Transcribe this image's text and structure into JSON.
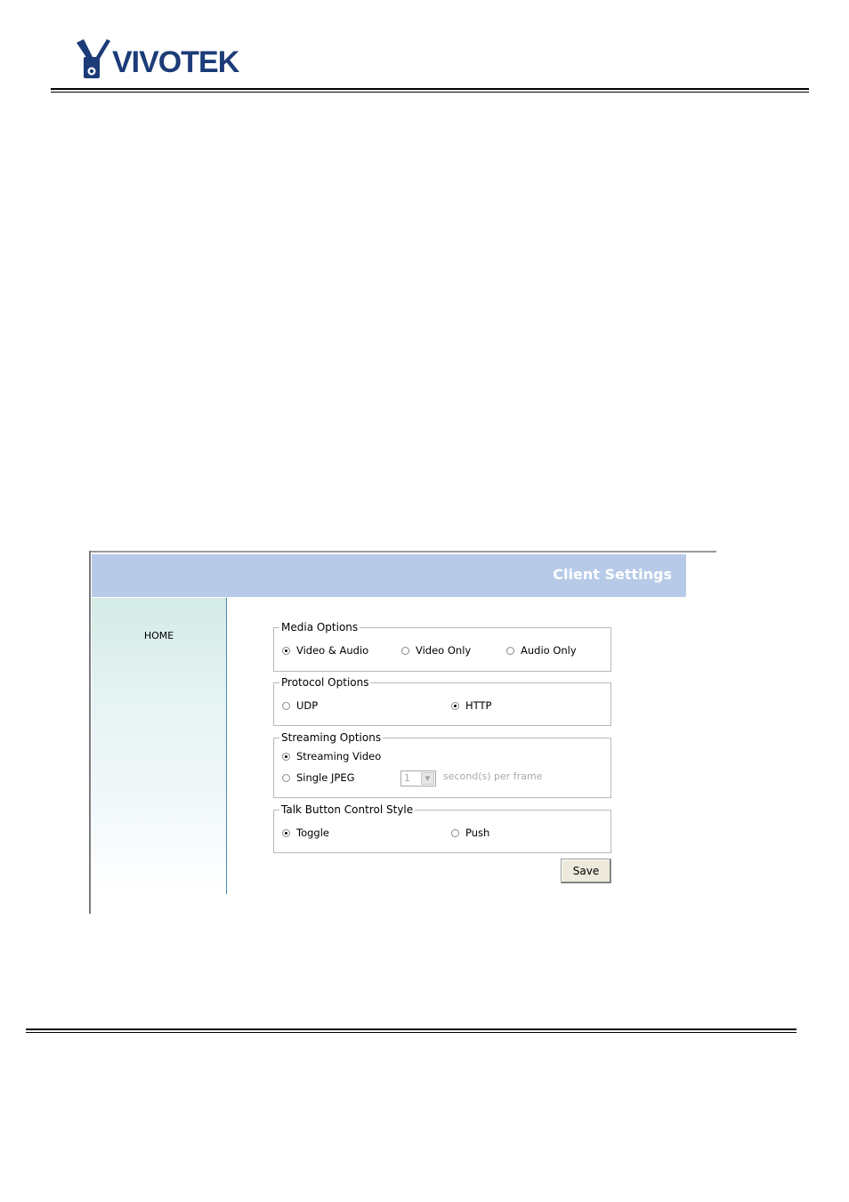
{
  "brand": {
    "logo_text": "VIVOTEK"
  },
  "window": {
    "title": "Client Settings"
  },
  "sidebar": {
    "home": "HOME"
  },
  "media_options": {
    "legend": "Media Options",
    "options": [
      "Video & Audio",
      "Video Only",
      "Audio Only"
    ],
    "selected": "Video & Audio"
  },
  "protocol_options": {
    "legend": "Protocol Options",
    "options": [
      "UDP",
      "HTTP"
    ],
    "selected": "HTTP"
  },
  "streaming_options": {
    "legend": "Streaming Options",
    "options": [
      "Streaming Video",
      "Single JPEG"
    ],
    "selected": "Streaming Video",
    "interval_value": "1",
    "interval_unit": "second(s) per frame"
  },
  "talk_button": {
    "legend": "Talk Button Control Style",
    "options": [
      "Toggle",
      "Push"
    ],
    "selected": "Toggle"
  },
  "actions": {
    "save": "Save"
  },
  "colors": {
    "title_bar": "#b7cae8",
    "title_text": "#ffffff",
    "sidebar_border": "#4a8ab4",
    "logo": "#1c3c78"
  }
}
